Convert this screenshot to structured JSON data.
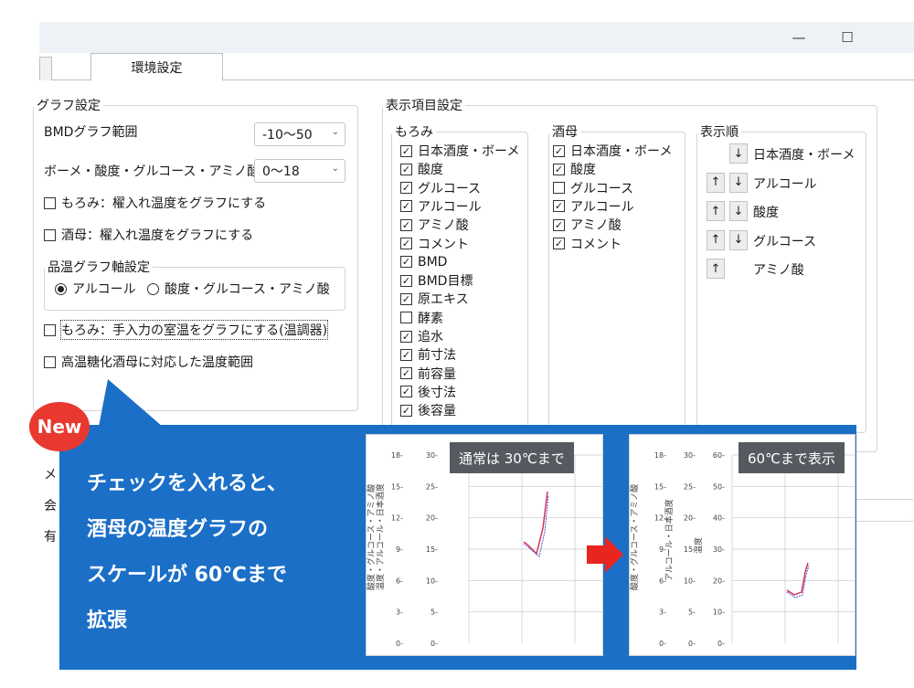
{
  "window": {
    "minimize_icon": "minimize-icon",
    "maximize_icon": "maximize-icon",
    "minimize_glyph": "—",
    "maximize_glyph": "☐"
  },
  "tab": {
    "label": "環境設定"
  },
  "graph_settings": {
    "title": "グラフ設定",
    "bmd_range_label": "BMDグラフ範囲",
    "bmd_range_value": "-10〜50",
    "baume_range_label": "ボーメ・酸度・グルコース・アミノ酸",
    "baume_range_value": "0〜18",
    "moromi_temp": "もろみ：櫂入れ温度をグラフにする",
    "shubo_temp": "酒母：櫂入れ温度をグラフにする",
    "axis_group_title": "品温グラフ軸設定",
    "axis_radio_alcohol": "アルコール",
    "axis_radio_other": "酸度・グルコース・アミノ酸",
    "manual_room_temp": "もろみ：手入力の室温をグラフにする(温調器)",
    "high_temp_range": "高温糖化酒母に対応した温度範囲"
  },
  "display_settings": {
    "title": "表示項目設定",
    "moromi": {
      "title": "もろみ",
      "items": [
        {
          "label": "日本酒度・ボーメ",
          "checked": true
        },
        {
          "label": "酸度",
          "checked": true
        },
        {
          "label": "グルコース",
          "checked": true
        },
        {
          "label": "アルコール",
          "checked": true
        },
        {
          "label": "アミノ酸",
          "checked": true
        },
        {
          "label": "コメント",
          "checked": true
        },
        {
          "label": "BMD",
          "checked": true
        },
        {
          "label": "BMD目標",
          "checked": true
        },
        {
          "label": "原エキス",
          "checked": true
        },
        {
          "label": "酵素",
          "checked": false
        },
        {
          "label": "追水",
          "checked": true
        },
        {
          "label": "前寸法",
          "checked": true
        },
        {
          "label": "前容量",
          "checked": true
        },
        {
          "label": "後寸法",
          "checked": true
        },
        {
          "label": "後容量",
          "checked": true
        }
      ]
    },
    "shubo": {
      "title": "酒母",
      "items": [
        {
          "label": "日本酒度・ボーメ",
          "checked": true
        },
        {
          "label": "酸度",
          "checked": true
        },
        {
          "label": "グルコース",
          "checked": false
        },
        {
          "label": "アルコール",
          "checked": true
        },
        {
          "label": "アミノ酸",
          "checked": true
        },
        {
          "label": "コメント",
          "checked": true
        }
      ]
    },
    "order": {
      "title": "表示順",
      "up_glyph": "↑",
      "down_glyph": "↓",
      "items": [
        "日本酒度・ボーメ",
        "アルコール",
        "酸度",
        "グルコース",
        "アミノ酸"
      ]
    }
  },
  "hidden_labels": {
    "row1": "メ",
    "row2": "会",
    "row3": "有"
  },
  "callout": {
    "badge": "New",
    "line1": "チェックを入れると、",
    "line2": "酒母の温度グラフの",
    "line3": "スケールが 60℃まで",
    "line4": "拡張",
    "chart_left_tag": "通常は 30℃まで",
    "chart_right_tag": "60℃まで表示",
    "left_axis_a_ticks": [
      "18",
      "15",
      "12",
      "9",
      "6",
      "3",
      "0"
    ],
    "left_axis_b_ticks": [
      "30",
      "25",
      "20",
      "15",
      "10",
      "5",
      "0"
    ],
    "left_axis_a_label": "酸度・グルコース・アミノ酸",
    "left_axis_b_label": "温度・アルコール・日本酒度",
    "right_axis_a_ticks": [
      "18",
      "15",
      "12",
      "9",
      "6",
      "3",
      "0"
    ],
    "right_axis_b_ticks": [
      "30",
      "25",
      "20",
      "15",
      "10",
      "5",
      "0"
    ],
    "right_axis_c_ticks": [
      "60",
      "50",
      "40",
      "30",
      "20",
      "10",
      "0"
    ],
    "right_axis_a_label": "酸度・グルコース・アミノ酸",
    "right_axis_b_label": "アルコール・日本酒度",
    "right_axis_c_label": "温度"
  },
  "colors": {
    "accent": "#1b6fc6",
    "badge": "#e8382f",
    "tag": "#555a60",
    "curve_red": "#d8274a",
    "curve_blue": "#5a5fd0"
  }
}
